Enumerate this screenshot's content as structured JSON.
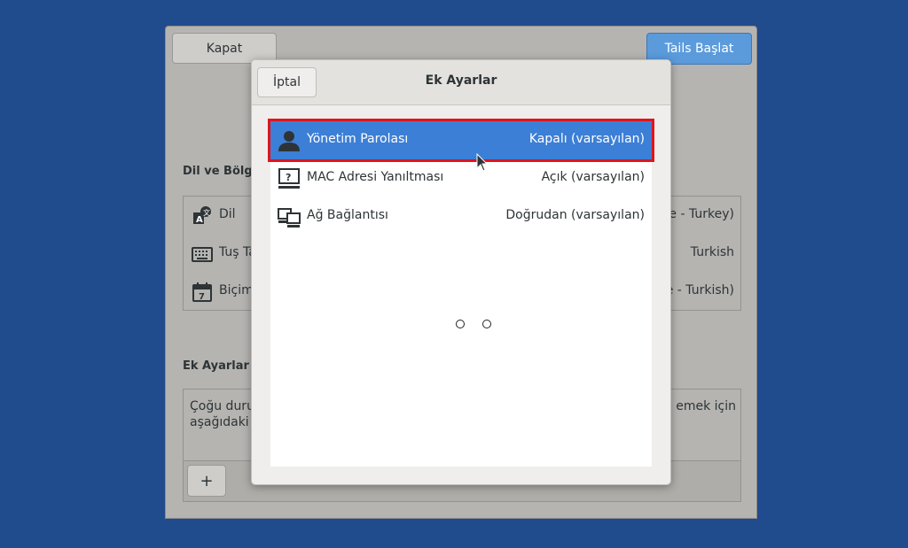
{
  "main": {
    "close_button": "Kapat",
    "start_button": "Tails Başlat",
    "language_section": "Dil ve Bölge",
    "language_rows": [
      {
        "icon": "language-icon",
        "label": "Dil",
        "value": "Türkçe (Türkiye - Turkey)"
      },
      {
        "icon": "keyboard-icon",
        "label": "Tuş Takımı Düzeni",
        "value": "Turkish"
      },
      {
        "icon": "calendar-icon",
        "label": "Biçimler",
        "value": "Türkçe (Türkiye - Turkish)"
      }
    ],
    "extra_section": "Ek Ayarlar",
    "extra_text_line1_left": "Çoğu durumda,",
    "extra_text_line1_right": "emek için",
    "extra_text_line2": "aşağıdaki",
    "add_button": "+"
  },
  "dialog": {
    "cancel_button": "İptal",
    "title": "Ek Ayarlar",
    "options": [
      {
        "icon": "user-icon",
        "label": "Yönetim Parolası",
        "value": "Kapalı (varsayılan)",
        "selected": true
      },
      {
        "icon": "mac-spoof-icon",
        "label": "MAC Adresi Yanıltması",
        "value": "Açık (varsayılan)",
        "selected": false
      },
      {
        "icon": "network-icon",
        "label": "Ağ Bağlantısı",
        "value": "Doğrudan (varsayılan)",
        "selected": false
      }
    ]
  },
  "colors": {
    "desktop": "#204b8c",
    "accent": "#3c7fd6",
    "highlight_outline": "#e0141d"
  }
}
